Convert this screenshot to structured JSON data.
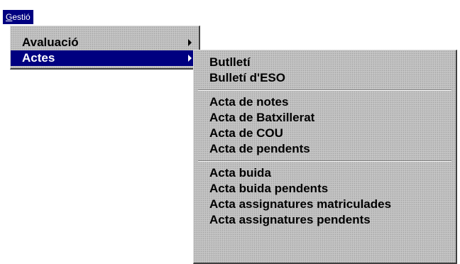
{
  "menubar": {
    "gestio_accel": "G",
    "gestio_rest": "estió"
  },
  "gestio_menu": {
    "items": [
      {
        "label": "Avaluació",
        "has_submenu": true,
        "selected": false
      },
      {
        "label": "Actes",
        "has_submenu": true,
        "selected": true
      }
    ]
  },
  "actes_menu": {
    "groups": [
      [
        "Butlletí",
        "Bulletí d'ESO"
      ],
      [
        "Acta de notes",
        "Acta de Batxillerat",
        "Acta de COU",
        "Acta de pendents"
      ],
      [
        "Acta buida",
        "Acta buida pendents",
        "Acta assignatures matriculades",
        "Acta assignatures pendents"
      ]
    ]
  },
  "colors": {
    "highlight": "#000080",
    "menu_face": "#c0c0c0"
  }
}
